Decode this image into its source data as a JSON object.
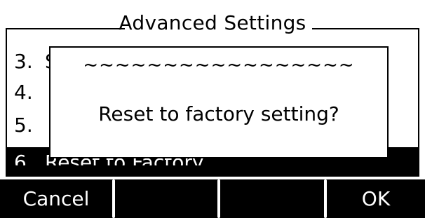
{
  "header": {
    "title": "Advanced Settings"
  },
  "list": {
    "items": [
      {
        "number": "3.",
        "label": "S"
      },
      {
        "number": "4.",
        "label": ""
      },
      {
        "number": "5.",
        "label": ""
      },
      {
        "number": "6.",
        "label": "Reset to Factory"
      }
    ],
    "selected_index": 3
  },
  "dialog": {
    "decoration": "~~~~~~~~~~~~~~~~~",
    "message": "Reset to factory setting?"
  },
  "softkeys": {
    "cancel": "Cancel",
    "key2": "",
    "key3": "",
    "ok": "OK"
  },
  "colors": {
    "background": "#ffffff",
    "foreground": "#000000",
    "selected_bg": "#000000",
    "selected_fg": "#ffffff"
  }
}
